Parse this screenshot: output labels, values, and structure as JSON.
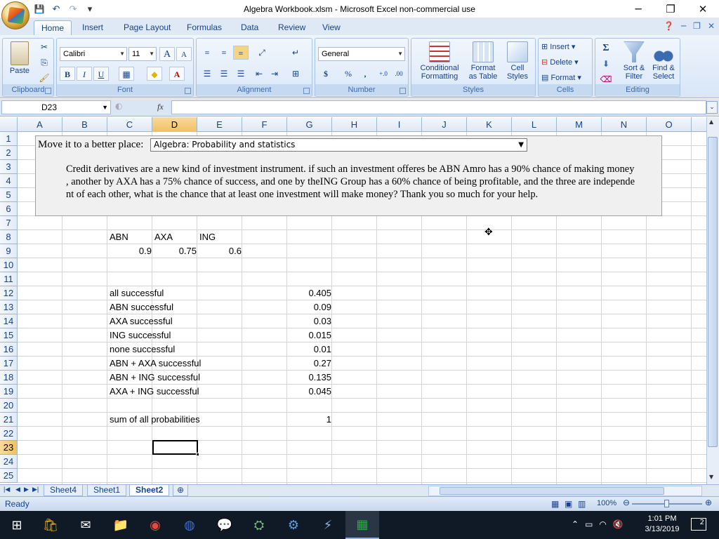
{
  "window": {
    "title": "Algebra Workbook.xlsm - Microsoft Excel non-commercial use",
    "minimize": "─",
    "restore": "❐",
    "close": "✕"
  },
  "qat": {
    "save": "💾",
    "undo": "↶",
    "redo": "↷",
    "customize": "▾"
  },
  "ribbon_tabs": [
    "Home",
    "Insert",
    "Page Layout",
    "Formulas",
    "Data",
    "Review",
    "View"
  ],
  "ribbon": {
    "clipboard": {
      "label": "Clipboard",
      "paste": "Paste"
    },
    "font": {
      "label": "Font",
      "name": "Calibri",
      "size": "11",
      "bold": "B",
      "italic": "I",
      "underline": "U",
      "grow": "A",
      "shrink": "A"
    },
    "alignment": {
      "label": "Alignment"
    },
    "number": {
      "label": "Number",
      "format": "General",
      "currency": "$",
      "percent": "%",
      "comma": ",",
      "inc_dec": "+.0",
      "dec_dec": ".00"
    },
    "styles": {
      "label": "Styles",
      "conditional": "Conditional",
      "conditional2": "Formatting",
      "format_table": "Format",
      "format_table2": "as Table",
      "cell_styles": "Cell",
      "cell_styles2": "Styles"
    },
    "cells": {
      "label": "Cells",
      "insert": "Insert",
      "delete": "Delete",
      "format": "Format"
    },
    "editing": {
      "label": "Editing",
      "sum": "Σ",
      "sort": "Sort &",
      "sort2": "Filter",
      "find": "Find &",
      "find2": "Select"
    }
  },
  "formula_bar": {
    "name_box": "D23",
    "fx": "fx",
    "formula": ""
  },
  "columns": [
    "A",
    "B",
    "C",
    "D",
    "E",
    "F",
    "G",
    "H",
    "I",
    "J",
    "K",
    "L",
    "M",
    "N",
    "O"
  ],
  "rows": [
    "1",
    "2",
    "3",
    "4",
    "5",
    "6",
    "7",
    "8",
    "9",
    "10",
    "11",
    "12",
    "13",
    "14",
    "15",
    "16",
    "17",
    "18",
    "19",
    "20",
    "21",
    "22",
    "23",
    "24",
    "25"
  ],
  "selected": {
    "column": "D",
    "row": "23"
  },
  "panel": {
    "move_label": "Move it to a better place:",
    "move_select": "Algebra: Probability and statistics",
    "question": "Credit derivatives are a new kind of investment instrument. if such an investment offeres be ABN Amro has a 90% chance of making money , another by AXA has a 75% chance of success, and one by theING Group has a 60% chance of being profitable, and the three are independent of each other, what is the chance that at least one investment will make money? Thank you so much for your help."
  },
  "table": {
    "headers": [
      "ABN",
      "AXA",
      "ING"
    ],
    "probs": [
      "0.9",
      "0.75",
      "0.6"
    ],
    "rows": [
      {
        "label": "all successful",
        "value": "0.405"
      },
      {
        "label": "ABN successful",
        "value": "0.09"
      },
      {
        "label": "AXA successful",
        "value": "0.03"
      },
      {
        "label": "ING successful",
        "value": "0.015"
      },
      {
        "label": "none successful",
        "value": "0.01"
      },
      {
        "label": "ABN + AXA successful",
        "value": "0.27"
      },
      {
        "label": "ABN + ING successful",
        "value": "0.135"
      },
      {
        "label": "AXA + ING successful",
        "value": "0.045"
      }
    ],
    "sum_label": "sum of all probabilities",
    "sum_value": "1"
  },
  "sheets": [
    "Sheet4",
    "Sheet1",
    "Sheet2"
  ],
  "status": {
    "ready": "Ready",
    "zoom": "100%"
  },
  "taskbar": {
    "time": "1:01 PM",
    "date": "3/13/2019",
    "notifications": "2"
  }
}
